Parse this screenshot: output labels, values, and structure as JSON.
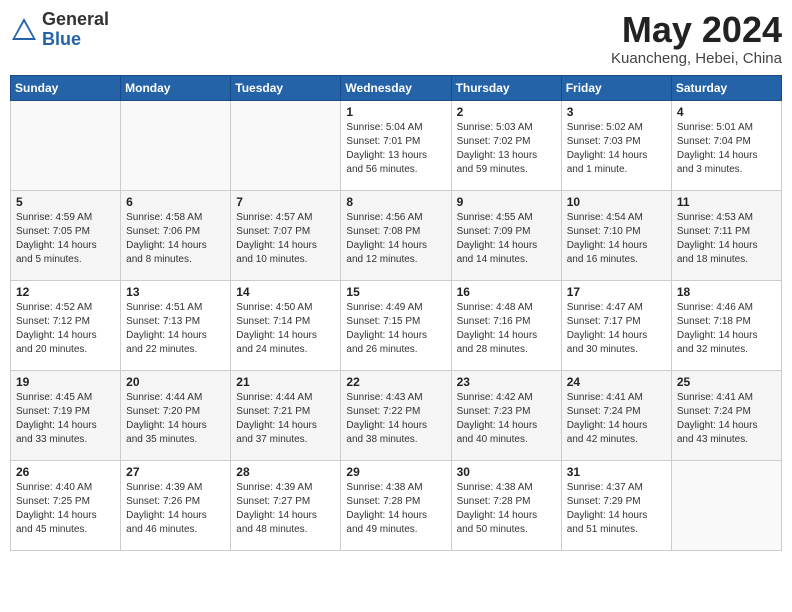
{
  "header": {
    "logo_general": "General",
    "logo_blue": "Blue",
    "month": "May 2024",
    "location": "Kuancheng, Hebei, China"
  },
  "weekdays": [
    "Sunday",
    "Monday",
    "Tuesday",
    "Wednesday",
    "Thursday",
    "Friday",
    "Saturday"
  ],
  "weeks": [
    [
      {
        "day": "",
        "sunrise": "",
        "sunset": "",
        "daylight": ""
      },
      {
        "day": "",
        "sunrise": "",
        "sunset": "",
        "daylight": ""
      },
      {
        "day": "",
        "sunrise": "",
        "sunset": "",
        "daylight": ""
      },
      {
        "day": "1",
        "sunrise": "Sunrise: 5:04 AM",
        "sunset": "Sunset: 7:01 PM",
        "daylight": "Daylight: 13 hours and 56 minutes."
      },
      {
        "day": "2",
        "sunrise": "Sunrise: 5:03 AM",
        "sunset": "Sunset: 7:02 PM",
        "daylight": "Daylight: 13 hours and 59 minutes."
      },
      {
        "day": "3",
        "sunrise": "Sunrise: 5:02 AM",
        "sunset": "Sunset: 7:03 PM",
        "daylight": "Daylight: 14 hours and 1 minute."
      },
      {
        "day": "4",
        "sunrise": "Sunrise: 5:01 AM",
        "sunset": "Sunset: 7:04 PM",
        "daylight": "Daylight: 14 hours and 3 minutes."
      }
    ],
    [
      {
        "day": "5",
        "sunrise": "Sunrise: 4:59 AM",
        "sunset": "Sunset: 7:05 PM",
        "daylight": "Daylight: 14 hours and 5 minutes."
      },
      {
        "day": "6",
        "sunrise": "Sunrise: 4:58 AM",
        "sunset": "Sunset: 7:06 PM",
        "daylight": "Daylight: 14 hours and 8 minutes."
      },
      {
        "day": "7",
        "sunrise": "Sunrise: 4:57 AM",
        "sunset": "Sunset: 7:07 PM",
        "daylight": "Daylight: 14 hours and 10 minutes."
      },
      {
        "day": "8",
        "sunrise": "Sunrise: 4:56 AM",
        "sunset": "Sunset: 7:08 PM",
        "daylight": "Daylight: 14 hours and 12 minutes."
      },
      {
        "day": "9",
        "sunrise": "Sunrise: 4:55 AM",
        "sunset": "Sunset: 7:09 PM",
        "daylight": "Daylight: 14 hours and 14 minutes."
      },
      {
        "day": "10",
        "sunrise": "Sunrise: 4:54 AM",
        "sunset": "Sunset: 7:10 PM",
        "daylight": "Daylight: 14 hours and 16 minutes."
      },
      {
        "day": "11",
        "sunrise": "Sunrise: 4:53 AM",
        "sunset": "Sunset: 7:11 PM",
        "daylight": "Daylight: 14 hours and 18 minutes."
      }
    ],
    [
      {
        "day": "12",
        "sunrise": "Sunrise: 4:52 AM",
        "sunset": "Sunset: 7:12 PM",
        "daylight": "Daylight: 14 hours and 20 minutes."
      },
      {
        "day": "13",
        "sunrise": "Sunrise: 4:51 AM",
        "sunset": "Sunset: 7:13 PM",
        "daylight": "Daylight: 14 hours and 22 minutes."
      },
      {
        "day": "14",
        "sunrise": "Sunrise: 4:50 AM",
        "sunset": "Sunset: 7:14 PM",
        "daylight": "Daylight: 14 hours and 24 minutes."
      },
      {
        "day": "15",
        "sunrise": "Sunrise: 4:49 AM",
        "sunset": "Sunset: 7:15 PM",
        "daylight": "Daylight: 14 hours and 26 minutes."
      },
      {
        "day": "16",
        "sunrise": "Sunrise: 4:48 AM",
        "sunset": "Sunset: 7:16 PM",
        "daylight": "Daylight: 14 hours and 28 minutes."
      },
      {
        "day": "17",
        "sunrise": "Sunrise: 4:47 AM",
        "sunset": "Sunset: 7:17 PM",
        "daylight": "Daylight: 14 hours and 30 minutes."
      },
      {
        "day": "18",
        "sunrise": "Sunrise: 4:46 AM",
        "sunset": "Sunset: 7:18 PM",
        "daylight": "Daylight: 14 hours and 32 minutes."
      }
    ],
    [
      {
        "day": "19",
        "sunrise": "Sunrise: 4:45 AM",
        "sunset": "Sunset: 7:19 PM",
        "daylight": "Daylight: 14 hours and 33 minutes."
      },
      {
        "day": "20",
        "sunrise": "Sunrise: 4:44 AM",
        "sunset": "Sunset: 7:20 PM",
        "daylight": "Daylight: 14 hours and 35 minutes."
      },
      {
        "day": "21",
        "sunrise": "Sunrise: 4:44 AM",
        "sunset": "Sunset: 7:21 PM",
        "daylight": "Daylight: 14 hours and 37 minutes."
      },
      {
        "day": "22",
        "sunrise": "Sunrise: 4:43 AM",
        "sunset": "Sunset: 7:22 PM",
        "daylight": "Daylight: 14 hours and 38 minutes."
      },
      {
        "day": "23",
        "sunrise": "Sunrise: 4:42 AM",
        "sunset": "Sunset: 7:23 PM",
        "daylight": "Daylight: 14 hours and 40 minutes."
      },
      {
        "day": "24",
        "sunrise": "Sunrise: 4:41 AM",
        "sunset": "Sunset: 7:24 PM",
        "daylight": "Daylight: 14 hours and 42 minutes."
      },
      {
        "day": "25",
        "sunrise": "Sunrise: 4:41 AM",
        "sunset": "Sunset: 7:24 PM",
        "daylight": "Daylight: 14 hours and 43 minutes."
      }
    ],
    [
      {
        "day": "26",
        "sunrise": "Sunrise: 4:40 AM",
        "sunset": "Sunset: 7:25 PM",
        "daylight": "Daylight: 14 hours and 45 minutes."
      },
      {
        "day": "27",
        "sunrise": "Sunrise: 4:39 AM",
        "sunset": "Sunset: 7:26 PM",
        "daylight": "Daylight: 14 hours and 46 minutes."
      },
      {
        "day": "28",
        "sunrise": "Sunrise: 4:39 AM",
        "sunset": "Sunset: 7:27 PM",
        "daylight": "Daylight: 14 hours and 48 minutes."
      },
      {
        "day": "29",
        "sunrise": "Sunrise: 4:38 AM",
        "sunset": "Sunset: 7:28 PM",
        "daylight": "Daylight: 14 hours and 49 minutes."
      },
      {
        "day": "30",
        "sunrise": "Sunrise: 4:38 AM",
        "sunset": "Sunset: 7:28 PM",
        "daylight": "Daylight: 14 hours and 50 minutes."
      },
      {
        "day": "31",
        "sunrise": "Sunrise: 4:37 AM",
        "sunset": "Sunset: 7:29 PM",
        "daylight": "Daylight: 14 hours and 51 minutes."
      },
      {
        "day": "",
        "sunrise": "",
        "sunset": "",
        "daylight": ""
      }
    ]
  ]
}
